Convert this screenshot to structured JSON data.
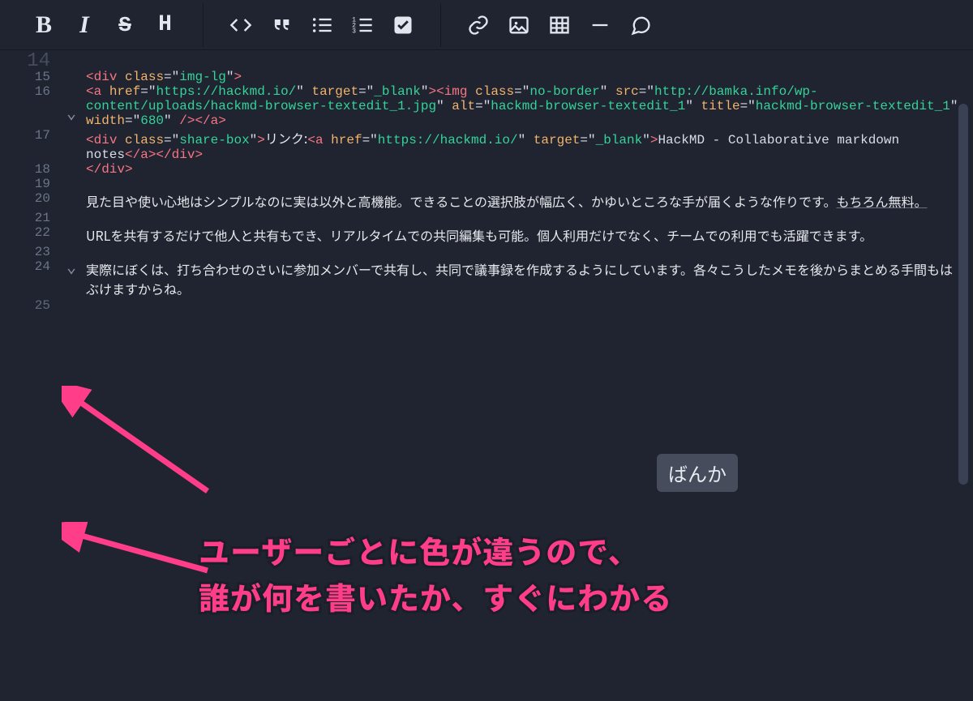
{
  "toolbar": {
    "bold": "B",
    "italic": "I",
    "strike": "S",
    "heading": "H",
    "code": "code",
    "quote": "quote",
    "ul": "ul",
    "ol": "ol",
    "task": "task",
    "link": "link",
    "image": "image",
    "table": "table",
    "hr": "hr",
    "comment": "comment"
  },
  "gutter": {
    "l14": "14",
    "l15": "15",
    "l16": "16",
    "l17": "17",
    "l18": "18",
    "l19": "19",
    "l20": "20",
    "l21": "21",
    "l22": "22",
    "l23": "23",
    "l24": "24",
    "l25": "25"
  },
  "code": {
    "l15": {
      "t1": "<",
      "t2": "div",
      "sp": " ",
      "a1": "class",
      "eq": "=",
      "q": "\"",
      "v1": "img-lg",
      "t3": ">"
    },
    "l16": {
      "t1": "<",
      "t2": "a",
      "a1": "href",
      "v1": "https://hackmd.io/",
      "a2": "target",
      "v2": "_blank",
      "t3": "><",
      "t4": "img",
      "a3": "class",
      "v3": "no-border",
      "a4": "src",
      "v4": "http://bamka.info/wp-content/uploads/hackmd-browser-textedit_1.jpg",
      "a5": "alt",
      "v5": "hackmd-browser-textedit_1",
      "a6": "title",
      "v6": "hackmd-browser-textedit_1",
      "a7": "width",
      "v7": "680",
      "t5": " /",
      "t6": "></",
      "t7": "a",
      "t8": ">"
    },
    "l17": {
      "t1": "<",
      "t2": "div",
      "a1": "class",
      "v1": "share-box",
      "t3": ">",
      "jp": "リンク:",
      "t4": "<",
      "t5": "a",
      "a2": "href",
      "v2": "https://hackmd.io/",
      "a3": "target",
      "v3": "_blank",
      "t6": ">",
      "txt": "HackMD - Collaborative markdown notes",
      "t7": "</",
      "t8": "a",
      "t9": "></",
      "t10": "div",
      "t11": ">"
    },
    "l18": {
      "t1": "</",
      "t2": "div",
      "t3": ">"
    },
    "l20": "見た目や使い心地はシンプルなのに実は以外と高機能。できることの選択肢が幅広く、かゆいところな手が届くような作りです。",
    "l20b": "もちろん無料。",
    "l22": "URLを共有するだけで他人と共有もでき、リアルタイムでの共同編集も可能。個人利用だけでなく、チームでの利用でも活躍できます。",
    "l24": "実際にぼくは、打ち合わせのさいに参加メンバーで共有し、共同で議事録を作成するようにしています。各々こうしたメモを後からまとめる手間もはぶけますからね。"
  },
  "user_chip": "ばんか",
  "annotation": {
    "line1": "ユーザーごとに色が違うので、",
    "line2": "誰が何を書いたか、すぐにわかる"
  }
}
